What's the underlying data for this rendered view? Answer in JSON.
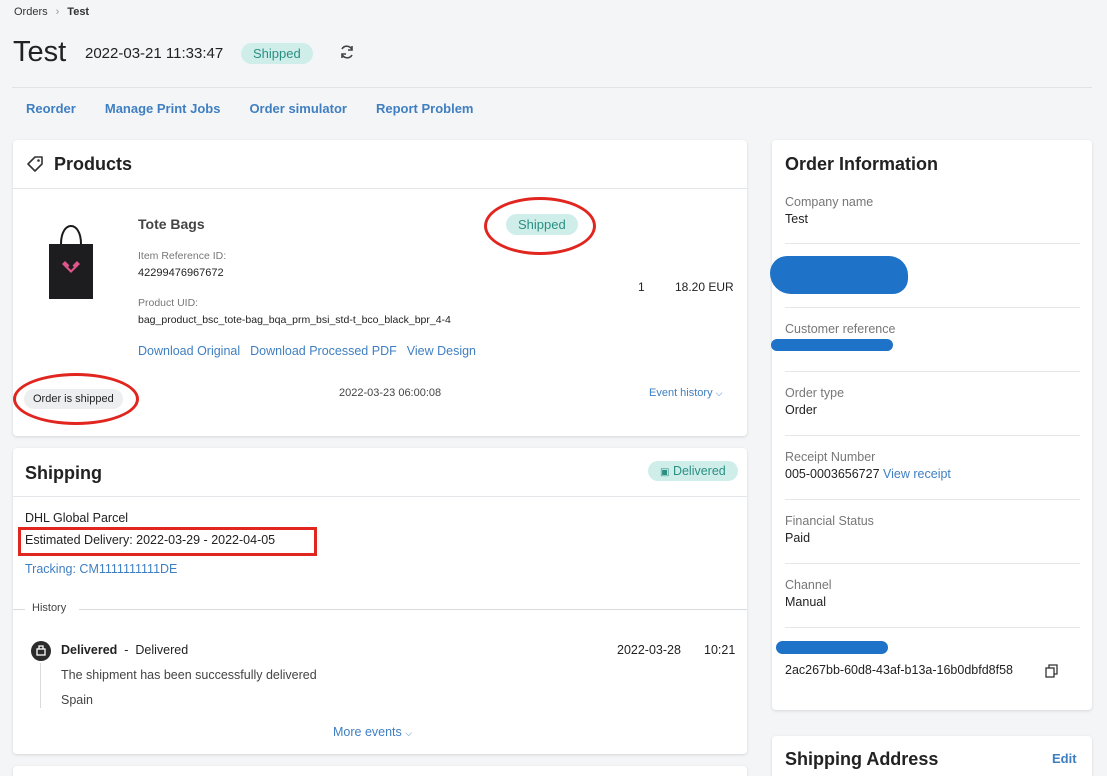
{
  "breadcrumb": {
    "parent": "Orders",
    "current": "Test"
  },
  "header": {
    "title": "Test",
    "date": "2022-03-21 11:33:47",
    "status": "Shipped"
  },
  "actions": [
    "Reorder",
    "Manage Print Jobs",
    "Order simulator",
    "Report Problem"
  ],
  "products": {
    "title": "Products",
    "item": {
      "name": "Tote Bags",
      "status": "Shipped",
      "ref_label": "Item Reference ID:",
      "ref_value": "42299476967672",
      "uid_label": "Product UID:",
      "uid_value": "bag_product_bsc_tote-bag_bqa_prm_bsi_std-t_bco_black_bpr_4-4",
      "quantity": "1",
      "price": "18.20 EUR",
      "links": [
        "Download Original",
        "Download Processed PDF",
        "View Design"
      ]
    },
    "event_status": "Order is shipped",
    "event_time": "2022-03-23 06:00:08",
    "event_history": "Event history"
  },
  "shipping": {
    "title": "Shipping",
    "status": "Delivered",
    "carrier": "DHL Global Parcel",
    "estimated": "Estimated Delivery: 2022-03-29 - 2022-04-05",
    "tracking": "Tracking: CM1111111111DE",
    "history_label": "History",
    "event": {
      "title": "Delivered",
      "dash": "-",
      "subtitle": "Delivered",
      "date": "2022-03-28",
      "time": "10:21",
      "description": "The shipment has been successfully delivered",
      "location": "Spain"
    },
    "more_events": "More events"
  },
  "order_info": {
    "title": "Order Information",
    "company_label": "Company name",
    "company_value": "Test",
    "customer_ref_label": "Customer reference",
    "order_type_label": "Order type",
    "order_type_value": "Order",
    "receipt_label": "Receipt Number",
    "receipt_value": "005-0003656727",
    "receipt_link": "View receipt",
    "financial_label": "Financial Status",
    "financial_value": "Paid",
    "channel_label": "Channel",
    "channel_value": "Manual",
    "id_value": "2ac267bb-60d8-43af-b13a-16b0dbfd8f58"
  },
  "shipping_address": {
    "title": "Shipping Address",
    "edit": "Edit"
  },
  "colors": {
    "accent": "#3f7fc1",
    "badge_bg": "#cfeeea",
    "badge_text": "#2a8f82",
    "annotation": "#e0261f",
    "redaction": "#1e72c8"
  }
}
